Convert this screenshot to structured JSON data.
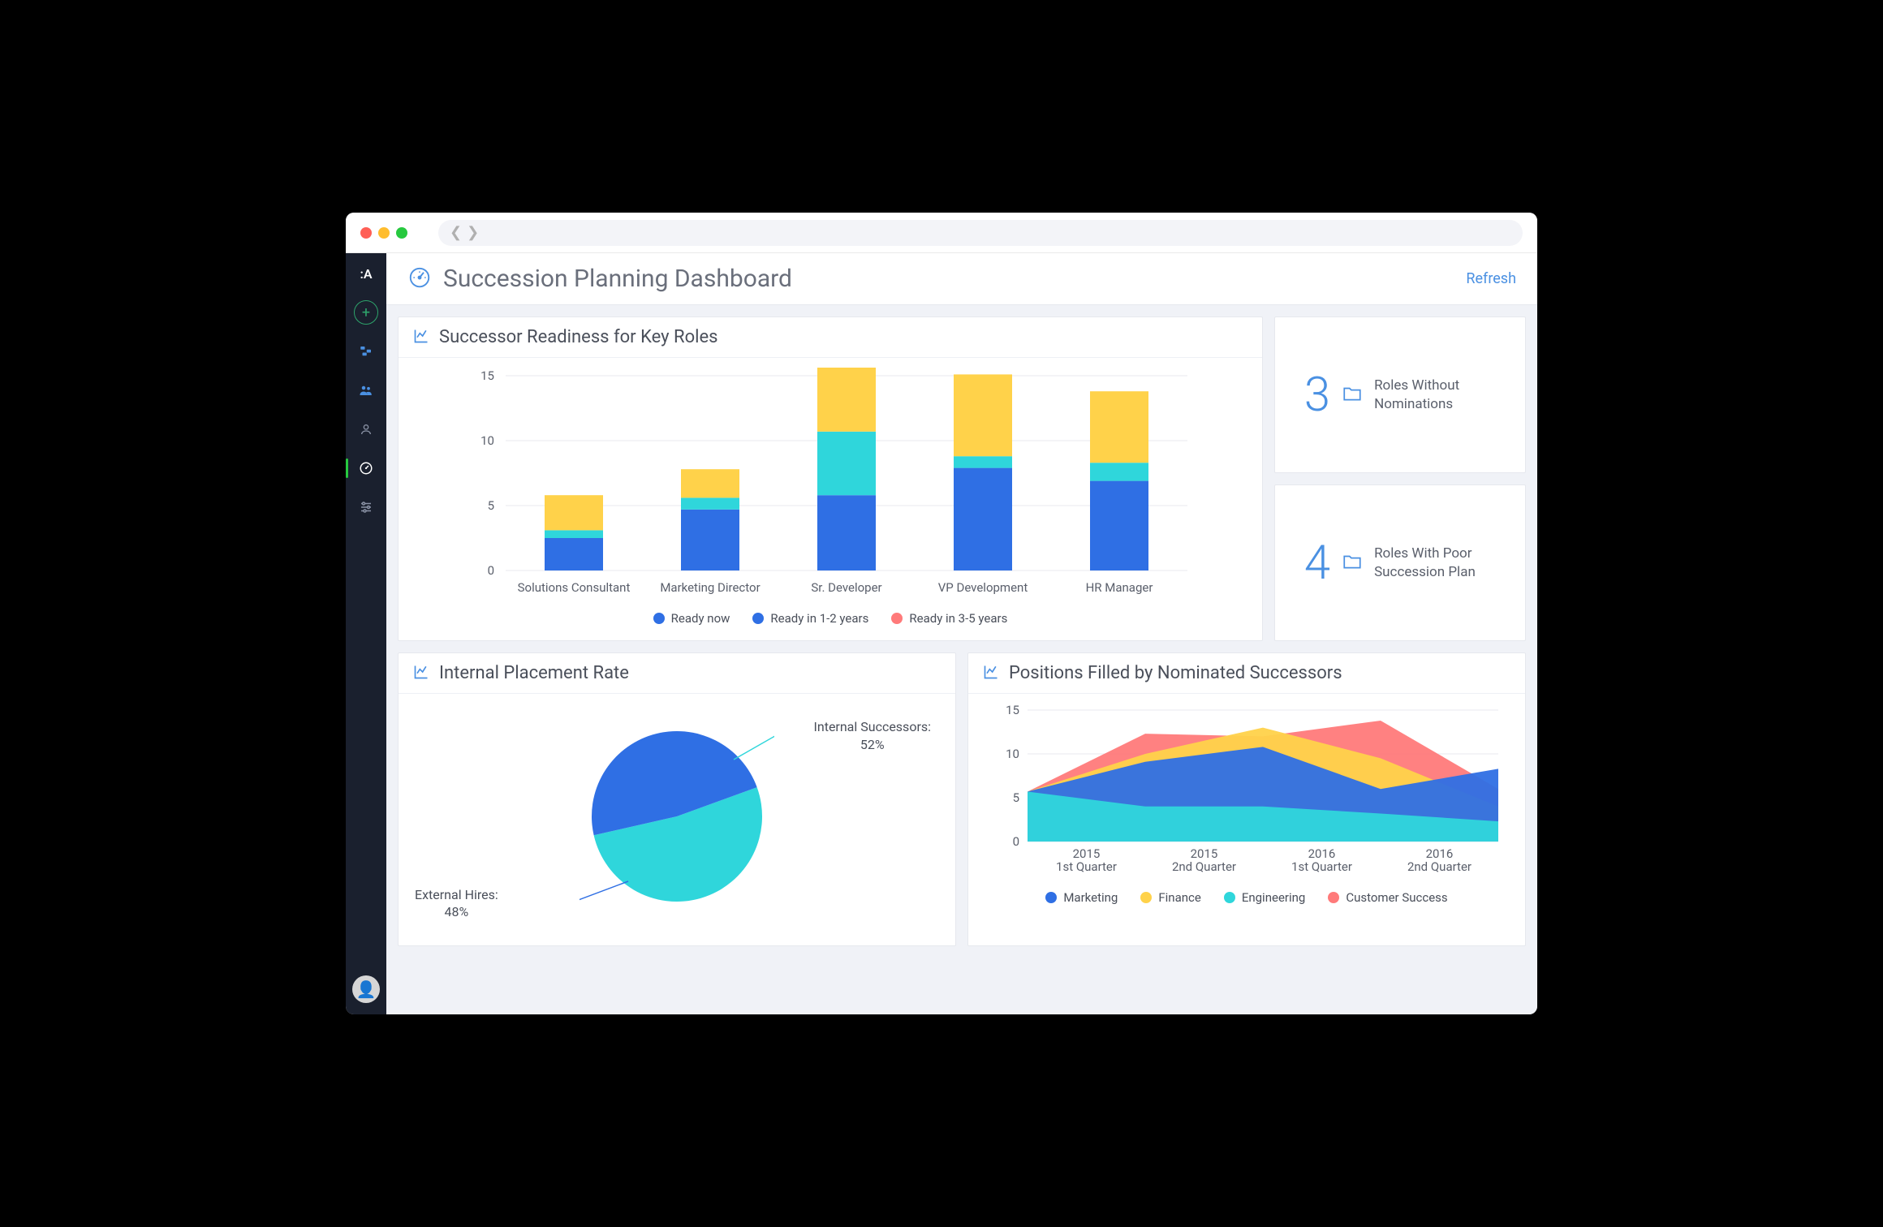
{
  "header": {
    "title": "Succession Planning Dashboard",
    "refresh": "Refresh"
  },
  "colors": {
    "blue": "#2f6fe4",
    "cyan": "#2fd6db",
    "yellow": "#ffd24a",
    "red": "#ff7a7a"
  },
  "stats": [
    {
      "value": "3",
      "label": "Roles Without Nominations"
    },
    {
      "value": "4",
      "label": "Roles With Poor Succession Plan"
    }
  ],
  "chart_data": [
    {
      "id": "readiness",
      "type": "bar",
      "title": "Successor Readiness for Key Roles",
      "categories": [
        "Solutions Consultant",
        "Marketing Director",
        "Sr. Developer",
        "VP Development",
        "HR Manager"
      ],
      "series": [
        {
          "name": "Ready now",
          "color": "#2f6fe4",
          "values": [
            2.5,
            4.7,
            5.8,
            7.9,
            6.9
          ]
        },
        {
          "name": "Ready in 1-2 years",
          "color": "#2fd6db",
          "values": [
            0.6,
            0.9,
            4.9,
            0.9,
            1.4
          ]
        },
        {
          "name": "Ready in 3-5 years",
          "color": "#ffd24a",
          "values": [
            2.7,
            2.2,
            5.5,
            6.3,
            5.5
          ]
        }
      ],
      "legend_colors": [
        "#2f6fe4",
        "#2f6fe4",
        "#ff7a7a"
      ],
      "ylim": [
        0,
        15
      ],
      "yticks": [
        0,
        5,
        10,
        15
      ]
    },
    {
      "id": "placement",
      "type": "pie",
      "title": "Internal Placement Rate",
      "slices": [
        {
          "name": "Internal Successors:",
          "pct": "52%",
          "value": 52,
          "color": "#2fd6db"
        },
        {
          "name": "External Hires:",
          "pct": "48%",
          "value": 48,
          "color": "#2f6fe4"
        }
      ]
    },
    {
      "id": "positions",
      "type": "area",
      "title": "Positions Filled by Nominated Successors",
      "x": [
        "2015\n1st Quarter",
        "2015\n2nd Quarter",
        "2016\n1st Quarter",
        "2016\n2nd Quarter"
      ],
      "series": [
        {
          "name": "Marketing",
          "color": "#2f6fe4"
        },
        {
          "name": "Finance",
          "color": "#ffd24a"
        },
        {
          "name": "Engineering",
          "color": "#2fd6db"
        },
        {
          "name": "Customer Success",
          "color": "#ff7a7a"
        }
      ],
      "layers": [
        {
          "name": "Customer Success",
          "color": "#ff7a7a",
          "values": [
            5.7,
            12.3,
            12.0,
            13.8,
            6.0
          ]
        },
        {
          "name": "Finance",
          "color": "#ffd24a",
          "values": [
            5.7,
            10.0,
            13.0,
            9.5,
            4.0
          ]
        },
        {
          "name": "Marketing",
          "color": "#2f6fe4",
          "values": [
            5.7,
            9.1,
            10.8,
            6.0,
            8.3
          ]
        },
        {
          "name": "Engineering",
          "color": "#2fd6db",
          "values": [
            5.7,
            4.0,
            4.0,
            3.2,
            2.3
          ]
        }
      ],
      "ylim": [
        0,
        15
      ],
      "yticks": [
        0,
        5,
        10,
        15
      ]
    }
  ]
}
